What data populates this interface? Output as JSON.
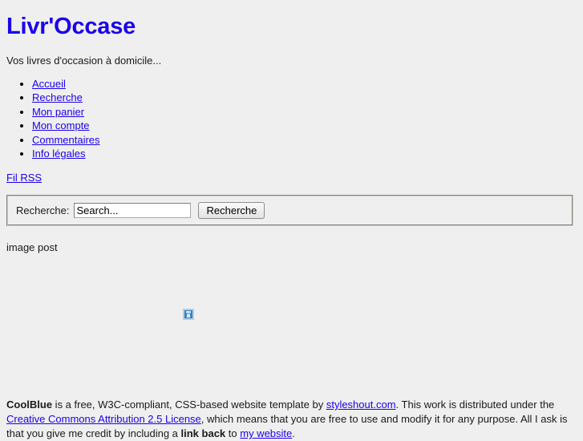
{
  "site": {
    "title": "Livr'Occase",
    "tagline": "Vos livres d'occasion à domicile..."
  },
  "nav": {
    "items": [
      {
        "label": "Accueil"
      },
      {
        "label": "Recherche"
      },
      {
        "label": "Mon panier"
      },
      {
        "label": "Mon compte"
      },
      {
        "label": "Commentaires"
      },
      {
        "label": "Info légales"
      }
    ],
    "rss_label": "Fil RSS"
  },
  "search": {
    "label": "Recherche:",
    "value": "Search...",
    "placeholder": "Search...",
    "button_label": "Recherche"
  },
  "content": {
    "post_label": "image post",
    "image_alt": "broken-image-icon"
  },
  "footer": {
    "brand": "CoolBlue",
    "text_1": " is a free, W3C-compliant, CSS-based website template by ",
    "link_1": "styleshout.com",
    "text_2": ". This work is distributed under the ",
    "link_2": "Creative Commons Attribution 2.5 License",
    "text_3": ", which means that you are free to use and modify it for any purpose. All I ask is that you give me credit by including a ",
    "bold_2": "link back",
    "text_4": " to ",
    "link_3": "my website",
    "text_5": "."
  },
  "colors": {
    "background": "#efefef",
    "link": "#1b00ec",
    "title": "#1b00ec",
    "text": "#1a1a1a"
  }
}
